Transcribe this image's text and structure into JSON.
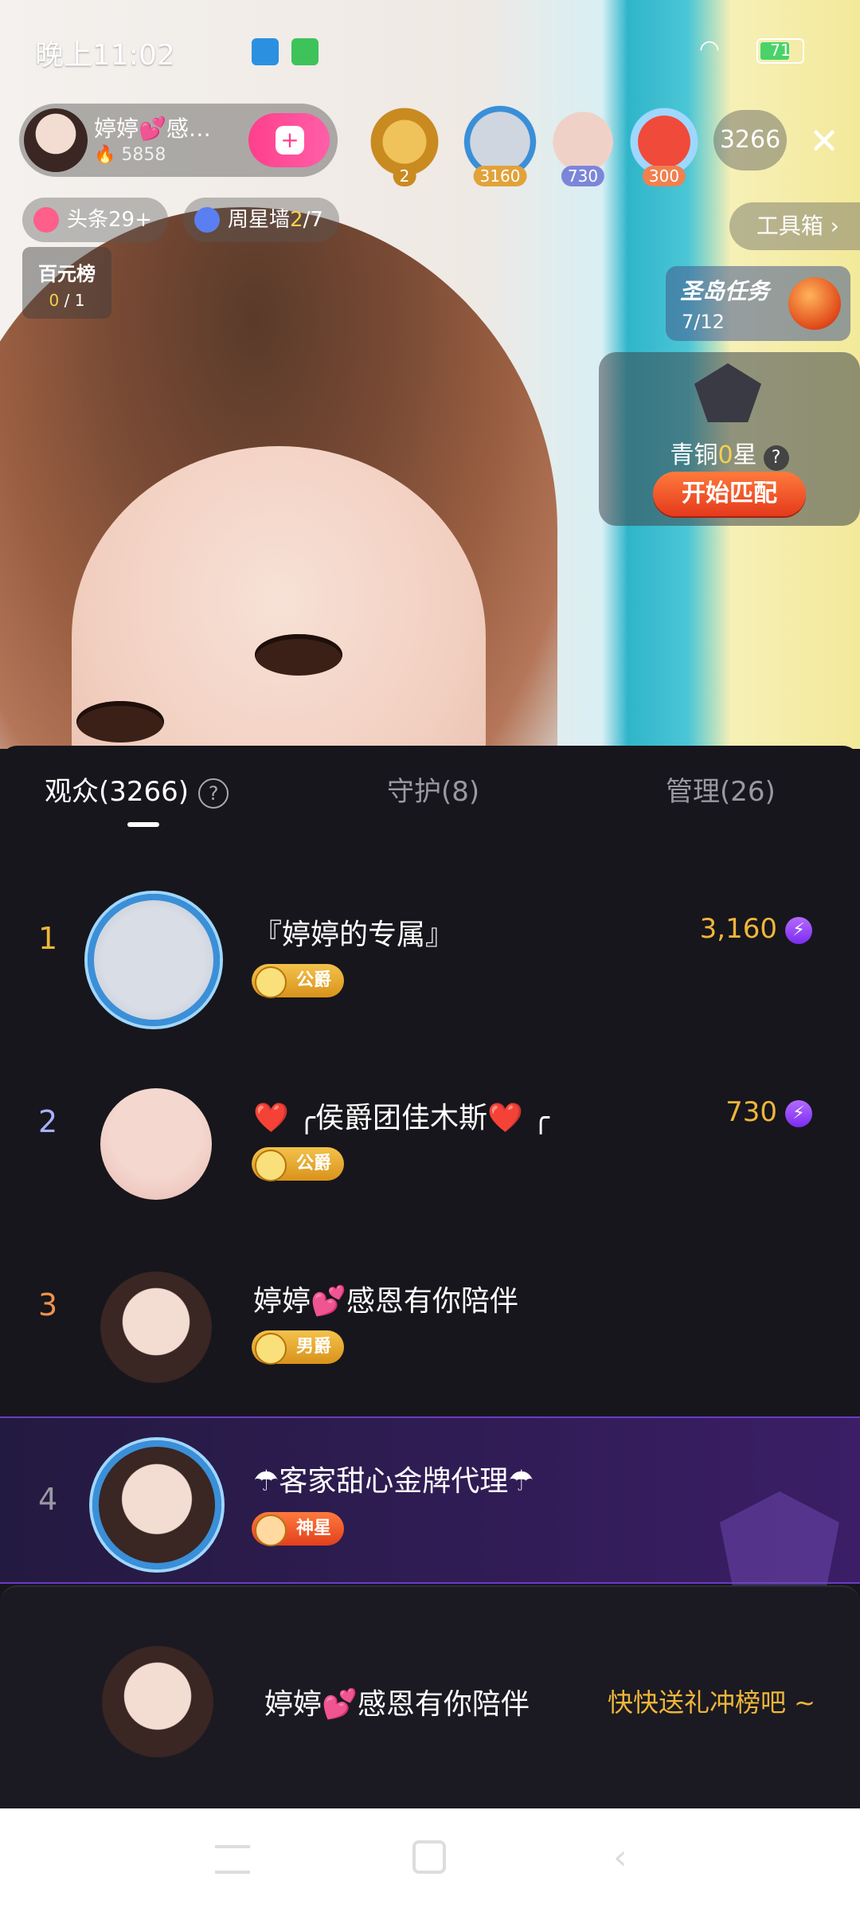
{
  "status_bar": {
    "time": "晚上11:02",
    "battery_level": "71"
  },
  "host": {
    "name": "婷婷💕感…",
    "fans": "5858"
  },
  "top_badges": [
    {
      "label": "2"
    },
    {
      "label": "3160"
    },
    {
      "label": "730"
    },
    {
      "label": "300"
    }
  ],
  "viewer_count": "3266",
  "chips": [
    {
      "label": "头条29+"
    },
    {
      "label": "周星墙",
      "accent": "2",
      "suffix": "/7"
    }
  ],
  "toolbox_label": "工具箱 ›",
  "baiyuan": {
    "title": "百元榜",
    "progress_done": "0",
    "progress_total": "/ 1"
  },
  "island_task": {
    "title": "圣岛任务",
    "progress": "7/12"
  },
  "match": {
    "level_prefix": "青铜",
    "level_num": "0",
    "level_suffix": "星",
    "help": "?",
    "button": "开始匹配"
  },
  "tabs": [
    {
      "label": "观众(3266)"
    },
    {
      "label": "守护(8)"
    },
    {
      "label": "管理(26)"
    }
  ],
  "help_icon": "?",
  "viewers": [
    {
      "rank": "1",
      "name": "『婷婷的专属』",
      "badge": "公爵",
      "score": "3,160",
      "rank_color": "#f0b63a"
    },
    {
      "rank": "2",
      "name": "❤️ ╭侯爵团佳木斯❤️ ╭",
      "badge": "公爵",
      "score": "730",
      "rank_color": "#a9b0ff"
    },
    {
      "rank": "3",
      "name": "婷婷💕感恩有你陪伴",
      "badge": "男爵",
      "score": "",
      "rank_color": "#f0924a"
    },
    {
      "rank": "4",
      "name": "☂客家甜心金牌代理☂",
      "badge": "神星",
      "score": "",
      "rank_color": "#9a99a3"
    }
  ],
  "footer": {
    "name": "婷婷💕感恩有你陪伴",
    "cta": "快快送礼冲榜吧 ~"
  },
  "icons": {
    "bolt": "⚡",
    "close": "✕"
  }
}
